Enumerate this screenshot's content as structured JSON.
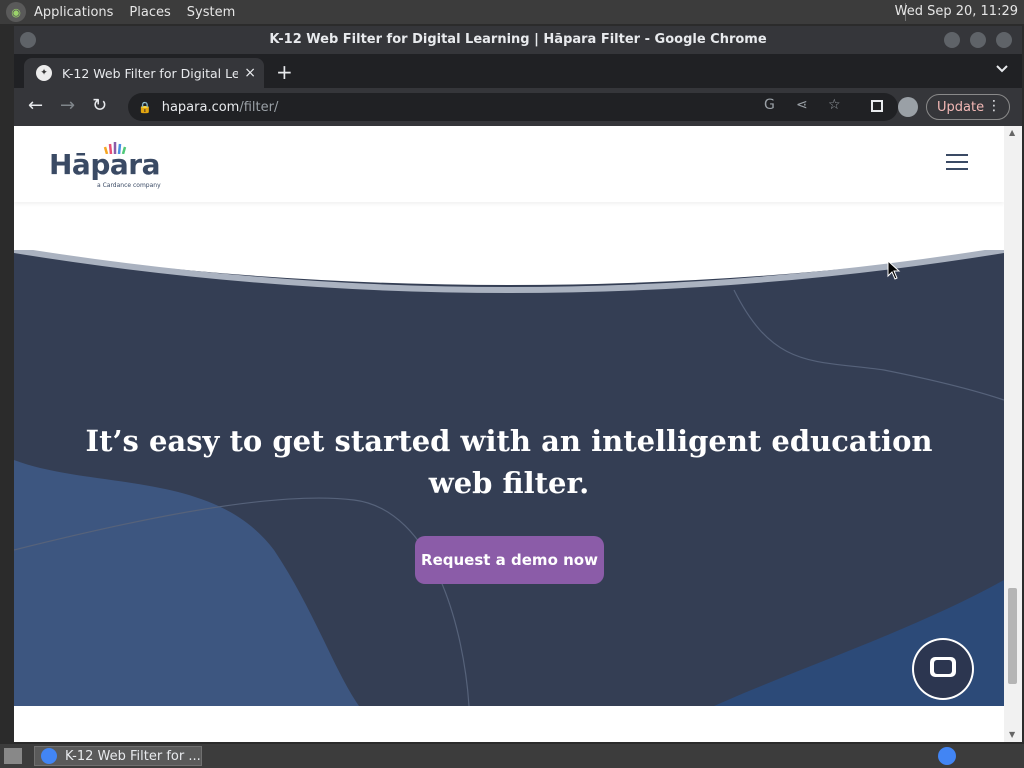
{
  "system_panel": {
    "menus": [
      "Applications",
      "Places",
      "System"
    ],
    "clock": "Wed Sep 20, 11:29"
  },
  "window": {
    "title": "K-12 Web Filter for Digital Learning | Hāpara Filter - Google Chrome"
  },
  "tab": {
    "title": "K-12 Web Filter for Digital Lea",
    "close_icon": "×",
    "new_tab_icon": "+",
    "tab_menu_icon": "⌄"
  },
  "toolbar": {
    "back_icon": "←",
    "forward_icon": "→",
    "reload_icon": "↻",
    "url_domain": "hapara.com",
    "url_path": "/filter/",
    "update_label": "Update"
  },
  "site": {
    "brand_name": "Hāpara",
    "brand_sub": "a Cardance company",
    "hero_title": "It’s easy to get started with an intelligent education web filter.",
    "cta_label": "Request a demo now"
  },
  "taskbar": {
    "task_label": "K-12 Web Filter for ..."
  },
  "colors": {
    "hero_bg": "#343e54",
    "hero_accent": "#3d5680",
    "cta": "#8b5ca8",
    "brand_text": "#3a4a64"
  }
}
